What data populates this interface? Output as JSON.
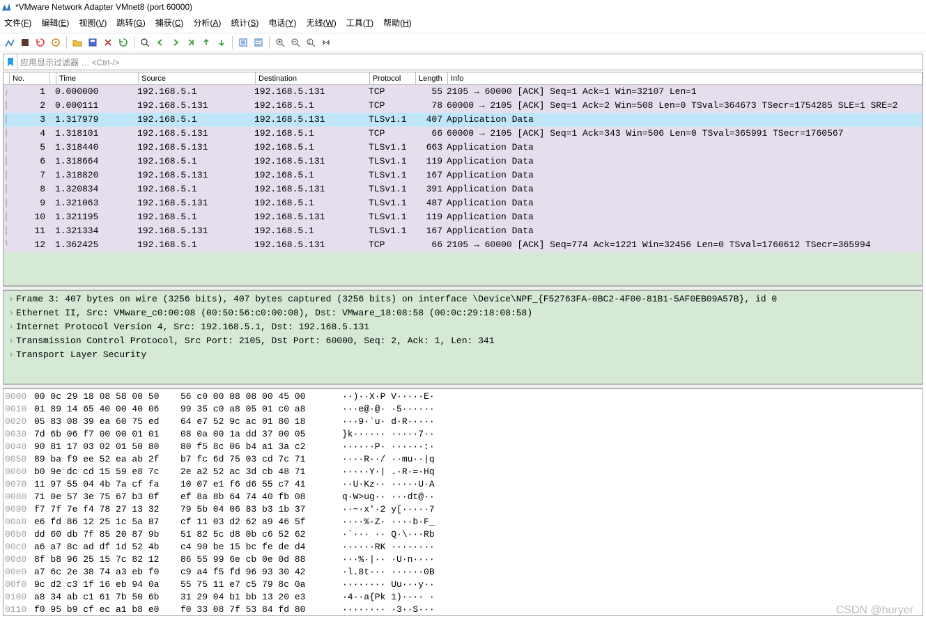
{
  "window": {
    "title": "*VMware Network Adapter VMnet8 (port 60000)"
  },
  "menus": [
    "文件(F)",
    "编辑(E)",
    "视图(V)",
    "跳转(G)",
    "捕获(C)",
    "分析(A)",
    "统计(S)",
    "电话(Y)",
    "无线(W)",
    "工具(T)",
    "帮助(H)"
  ],
  "filter_hint": "应用显示过滤器 … <Ctrl-/>",
  "cols": {
    "no": "No.",
    "time": "Time",
    "src": "Source",
    "dst": "Destination",
    "proto": "Protocol",
    "len": "Length",
    "info": "Info"
  },
  "rows": [
    {
      "no": "1",
      "time": "0.000000",
      "src": "192.168.5.1",
      "dst": "192.168.5.131",
      "proto": "TCP",
      "len": "55",
      "info": "2105 → 60000 [ACK] Seq=1 Ack=1 Win=32107 Len=1"
    },
    {
      "no": "2",
      "time": "0.000111",
      "src": "192.168.5.131",
      "dst": "192.168.5.1",
      "proto": "TCP",
      "len": "78",
      "info": "60000 → 2105 [ACK] Seq=1 Ack=2 Win=508 Len=0 TSval=364673 TSecr=1754285 SLE=1 SRE=2"
    },
    {
      "no": "3",
      "time": "1.317979",
      "src": "192.168.5.1",
      "dst": "192.168.5.131",
      "proto": "TLSv1.1",
      "len": "407",
      "info": "Application Data"
    },
    {
      "no": "4",
      "time": "1.318101",
      "src": "192.168.5.131",
      "dst": "192.168.5.1",
      "proto": "TCP",
      "len": "66",
      "info": "60000 → 2105 [ACK] Seq=1 Ack=343 Win=506 Len=0 TSval=365991 TSecr=1760567"
    },
    {
      "no": "5",
      "time": "1.318440",
      "src": "192.168.5.131",
      "dst": "192.168.5.1",
      "proto": "TLSv1.1",
      "len": "663",
      "info": "Application Data"
    },
    {
      "no": "6",
      "time": "1.318664",
      "src": "192.168.5.1",
      "dst": "192.168.5.131",
      "proto": "TLSv1.1",
      "len": "119",
      "info": "Application Data"
    },
    {
      "no": "7",
      "time": "1.318820",
      "src": "192.168.5.131",
      "dst": "192.168.5.1",
      "proto": "TLSv1.1",
      "len": "167",
      "info": "Application Data"
    },
    {
      "no": "8",
      "time": "1.320834",
      "src": "192.168.5.1",
      "dst": "192.168.5.131",
      "proto": "TLSv1.1",
      "len": "391",
      "info": "Application Data"
    },
    {
      "no": "9",
      "time": "1.321063",
      "src": "192.168.5.131",
      "dst": "192.168.5.1",
      "proto": "TLSv1.1",
      "len": "487",
      "info": "Application Data"
    },
    {
      "no": "10",
      "time": "1.321195",
      "src": "192.168.5.1",
      "dst": "192.168.5.131",
      "proto": "TLSv1.1",
      "len": "119",
      "info": "Application Data"
    },
    {
      "no": "11",
      "time": "1.321334",
      "src": "192.168.5.131",
      "dst": "192.168.5.1",
      "proto": "TLSv1.1",
      "len": "167",
      "info": "Application Data"
    },
    {
      "no": "12",
      "time": "1.362425",
      "src": "192.168.5.1",
      "dst": "192.168.5.131",
      "proto": "TCP",
      "len": "66",
      "info": "2105 → 60000 [ACK] Seq=774 Ack=1221 Win=32456 Len=0 TSval=1760612 TSecr=365994"
    }
  ],
  "selected_row": 2,
  "details": [
    "Frame 3: 407 bytes on wire (3256 bits), 407 bytes captured (3256 bits) on interface \\Device\\NPF_{F52763FA-0BC2-4F00-81B1-5AF0EB09A57B}, id 0",
    "Ethernet II, Src: VMware_c0:00:08 (00:50:56:c0:00:08), Dst: VMware_18:08:58 (00:0c:29:18:08:58)",
    "Internet Protocol Version 4, Src: 192.168.5.1, Dst: 192.168.5.131",
    "Transmission Control Protocol, Src Port: 2105, Dst Port: 60000, Seq: 2, Ack: 1, Len: 341",
    "Transport Layer Security"
  ],
  "hex": [
    {
      "o": "0000",
      "h1": "00 0c 29 18 08 58 00 50",
      "h2": "56 c0 00 08 08 00 45 00",
      "a": "··)··X·P V·····E·"
    },
    {
      "o": "0010",
      "h1": "01 89 14 65 40 00 40 06",
      "h2": "99 35 c0 a8 05 01 c0 a8",
      "a": "···e@·@· ·5······"
    },
    {
      "o": "0020",
      "h1": "05 83 08 39 ea 60 75 ed",
      "h2": "64 e7 52 9c ac 01 80 18",
      "a": "···9·`u· d·R·····"
    },
    {
      "o": "0030",
      "h1": "7d 6b 06 f7 00 00 01 01",
      "h2": "08 0a 00 1a dd 37 00 05",
      "a": "}k······ ·····7··"
    },
    {
      "o": "0040",
      "h1": "90 81 17 03 02 01 50 80",
      "h2": "80 f5 8c 06 b4 a1 3a c2",
      "a": "······P· ······:·"
    },
    {
      "o": "0050",
      "h1": "89 ba f9 ee 52 ea ab 2f",
      "h2": "b7 fc 6d 75 03 cd 7c 71",
      "a": "····R··/ ··mu··|q"
    },
    {
      "o": "0060",
      "h1": "b0 9e dc cd 15 59 e8 7c",
      "h2": "2e a2 52 ac 3d cb 48 71",
      "a": "·····Y·| .·R·=·Hq"
    },
    {
      "o": "0070",
      "h1": "11 97 55 04 4b 7a cf fa",
      "h2": "10 07 e1 f6 d6 55 c7 41",
      "a": "··U·Kz·· ·····U·A"
    },
    {
      "o": "0080",
      "h1": "71 0e 57 3e 75 67 b3 0f",
      "h2": "ef 8a 8b 64 74 40 fb 08",
      "a": "q·W>ug·· ···dt@··"
    },
    {
      "o": "0090",
      "h1": "f7 7f 7e f4 78 27 13 32",
      "h2": "79 5b 04 06 83 b3 1b 37",
      "a": "··~·x'·2 y[·····7"
    },
    {
      "o": "00a0",
      "h1": "e6 fd 86 12 25 1c 5a 87",
      "h2": "cf 11 03 d2 62 a9 46 5f",
      "a": "····%·Z· ····b·F_"
    },
    {
      "o": "00b0",
      "h1": "dd 60 db 7f 85 20 87 9b",
      "h2": "51 82 5c d8 0b c6 52 62",
      "a": "·`··· ·· Q·\\···Rb"
    },
    {
      "o": "00c0",
      "h1": "a6 a7 8c ad df 1d 52 4b",
      "h2": "c4 90 be 15 bc fe de d4",
      "a": "······RK ········"
    },
    {
      "o": "00d0",
      "h1": "8f b8 96 25 15 7c 82 12",
      "h2": "86 55 99 6e cb 0e 0d 88",
      "a": "···%·|·· ·U·n····"
    },
    {
      "o": "00e0",
      "h1": "a7 6c 2e 38 74 a3 eb f0",
      "h2": "c9 a4 f5 fd 96 93 30 42",
      "a": "·l.8t··· ······0B"
    },
    {
      "o": "00f0",
      "h1": "9c d2 c3 1f 16 eb 94 0a",
      "h2": "55 75 11 e7 c5 79 8c 0a",
      "a": "········ Uu···y··"
    },
    {
      "o": "0100",
      "h1": "a8 34 ab c1 61 7b 50 6b",
      "h2": "31 29 04 b1 bb 13 20 e3",
      "a": "·4··a{Pk 1)···· ·"
    },
    {
      "o": "0110",
      "h1": "f0 95 b9 cf ec a1 b8 e0",
      "h2": "f0 33 08 7f 53 84 fd 80",
      "a": "········ ·3··S···"
    }
  ],
  "watermark": "CSDN @huryer",
  "colors": {
    "row_purple": "#e6deed",
    "row_selected": "#bfe6f8",
    "pane_green": "#d5e9d5"
  }
}
